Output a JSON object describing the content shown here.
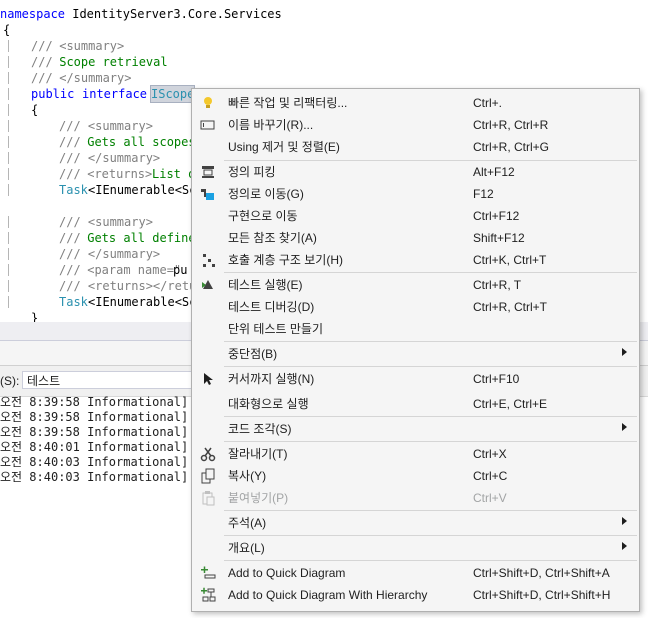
{
  "editor": {
    "line_namespace_kw": "namespace",
    "line_namespace_name": " IdentityServer3.Core.Services",
    "brace_open": "{",
    "doc1_slashes": "///",
    "doc1_tag": " <summary>",
    "doc2_slashes": "///",
    "doc2_text": " Scope retrieval",
    "doc3_slashes": "///",
    "doc3_tag": " </summary>",
    "iface_kw1": "public",
    "iface_kw2": "interface",
    "iface_name": "IScope",
    "inner_brace": "{",
    "m1_doc1": "/// <summary>",
    "m1_doc2_slashes": "///",
    "m1_doc2_text": " Gets all scopes",
    "m1_doc3": "/// </summary>",
    "m1_doc4_slashes": "///",
    "m1_doc4_tag": " <returns>",
    "m1_doc4_text": "List o",
    "m1_sig_type": "Task",
    "m1_sig_rest": "<IEnumerable<Sc",
    "m2_doc1": "/// <summary>",
    "m2_doc2_slashes": "///",
    "m2_doc2_text": " Gets all define",
    "m2_doc3": "/// </summary>",
    "m2_doc4_slashes": "///",
    "m2_doc4_tag": " <param name=\"",
    "m2_doc4_text": "pu",
    "m2_doc5": "/// <returns></retu",
    "m2_sig_type": "Task",
    "m2_sig_rest": "<IEnumerable<Sc",
    "close_brace": "}"
  },
  "output": {
    "source_label": "(S):",
    "source_value": "테스트",
    "lines": [
      "오전 8:39:58 Informational] ----",
      "오전 8:39:58 Informational] ====",
      "오전 8:39:58 Informational] ----",
      "오전 8:40:01 Informational] [xUn",
      "오전 8:40:03 Informational] [xUn",
      "오전 8:40:03 Informational] ===="
    ]
  },
  "menu": {
    "items": [
      {
        "label": "빠른 작업 및 리팩터링...",
        "shortcut": "Ctrl+.",
        "icon": "lightbulb-icon"
      },
      {
        "label": "이름 바꾸기(R)...",
        "shortcut": "Ctrl+R, Ctrl+R",
        "icon": "rename-icon"
      },
      {
        "label": "Using 제거 및 정렬(E)",
        "shortcut": "Ctrl+R, Ctrl+G",
        "icon": ""
      },
      {
        "label": "정의 피킹",
        "shortcut": "Alt+F12",
        "icon": "peek-definition-icon"
      },
      {
        "label": "정의로 이동(G)",
        "shortcut": "F12",
        "icon": "go-to-definition-icon"
      },
      {
        "label": "구현으로 이동",
        "shortcut": "Ctrl+F12",
        "icon": ""
      },
      {
        "label": "모든 참조 찾기(A)",
        "shortcut": "Shift+F12",
        "icon": ""
      },
      {
        "label": "호출 계층 구조 보기(H)",
        "shortcut": "Ctrl+K, Ctrl+T",
        "icon": "call-hierarchy-icon"
      },
      {
        "label": "테스트 실행(E)",
        "shortcut": "Ctrl+R, T",
        "icon": "run-test-icon"
      },
      {
        "label": "테스트 디버깅(D)",
        "shortcut": "Ctrl+R, Ctrl+T",
        "icon": ""
      },
      {
        "label": "단위 테스트 만들기",
        "shortcut": "",
        "icon": ""
      },
      {
        "label": "중단점(B)",
        "shortcut": "",
        "icon": ""
      },
      {
        "label": "커서까지 실행(N)",
        "shortcut": "Ctrl+F10",
        "icon": "run-to-cursor-icon"
      },
      {
        "label": "대화형으로 실행",
        "shortcut": "Ctrl+E, Ctrl+E",
        "icon": ""
      },
      {
        "label": "코드 조각(S)",
        "shortcut": "",
        "icon": ""
      },
      {
        "label": "잘라내기(T)",
        "shortcut": "Ctrl+X",
        "icon": "cut-icon"
      },
      {
        "label": "복사(Y)",
        "shortcut": "Ctrl+C",
        "icon": "copy-icon"
      },
      {
        "label": "붙여넣기(P)",
        "shortcut": "Ctrl+V",
        "icon": "paste-icon"
      },
      {
        "label": "주석(A)",
        "shortcut": "",
        "icon": ""
      },
      {
        "label": "개요(L)",
        "shortcut": "",
        "icon": ""
      },
      {
        "label": "Add to Quick Diagram",
        "shortcut": "Ctrl+Shift+D, Ctrl+Shift+A",
        "icon": "add-diagram-icon"
      },
      {
        "label": "Add to Quick Diagram With Hierarchy",
        "shortcut": "Ctrl+Shift+D, Ctrl+Shift+H",
        "icon": "add-diagram-hierarchy-icon"
      }
    ]
  },
  "colors": {
    "keyword": "#0000ff",
    "comment": "#008000",
    "doc_tag": "#808080",
    "type": "#2b91af",
    "menu_bg": "#f5f5f5"
  }
}
